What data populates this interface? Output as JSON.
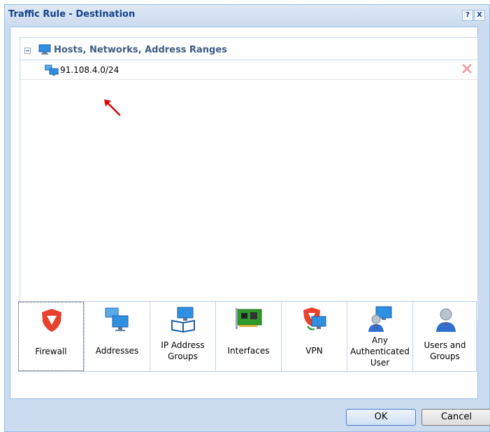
{
  "window": {
    "title": "Traffic Rule - Destination",
    "help_label": "?",
    "close_label": "X"
  },
  "tree": {
    "group_label": "Hosts, Networks, Address Ranges",
    "entries": [
      {
        "label": "91.108.4.0/24",
        "icon": "network-icon"
      }
    ]
  },
  "palette": {
    "items": [
      {
        "label": "Firewall",
        "icon": "firewall-shield-icon",
        "selected": true
      },
      {
        "label": "Addresses",
        "icon": "addresses-icon"
      },
      {
        "label": "IP Address Groups",
        "icon": "ip-address-groups-icon"
      },
      {
        "label": "Interfaces",
        "icon": "interfaces-card-icon"
      },
      {
        "label": "VPN",
        "icon": "vpn-icon"
      },
      {
        "label": "Any Authenticated User",
        "icon": "authenticated-user-icon"
      },
      {
        "label": "Users and Groups",
        "icon": "users-groups-icon"
      }
    ]
  },
  "buttons": {
    "ok_label": "OK",
    "cancel_label": "Cancel"
  },
  "colors": {
    "title_text": "#15428b",
    "dialog_background": "#cbdcf0",
    "arrow_annotation": "#e00000",
    "remove_icon": "#f0a0a0"
  }
}
